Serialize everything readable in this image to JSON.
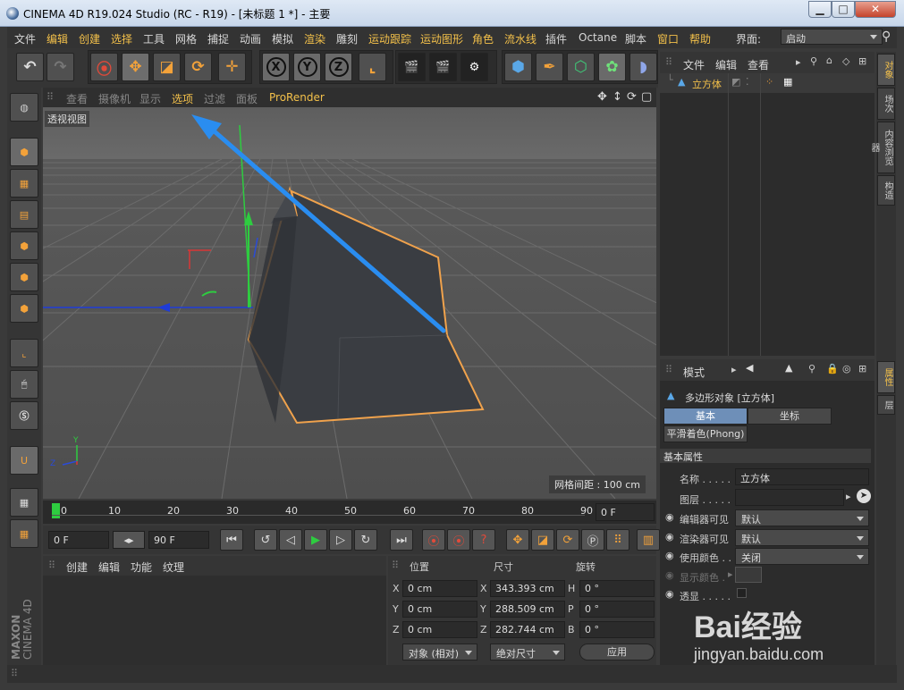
{
  "window": {
    "title": "CINEMA 4D R19.024 Studio (RC - R19) - [未标题 1 *] - 主要",
    "minimize": "▁",
    "maximize": "□",
    "close": "✕"
  },
  "menu": {
    "items": [
      "文件",
      "编辑",
      "创建",
      "选择",
      "工具",
      "网格",
      "捕捉",
      "动画",
      "模拟",
      "渲染",
      "雕刻",
      "运动跟踪",
      "运动图形",
      "角色",
      "流水线",
      "插件",
      "Octane",
      "脚本",
      "窗口",
      "帮助"
    ],
    "layout_label": "界面:",
    "layout_value": "启动"
  },
  "toolbar": {
    "axis_x": "X",
    "axis_y": "Y",
    "axis_z": "Z"
  },
  "viewport": {
    "menu": [
      "查看",
      "摄像机",
      "显示",
      "选项",
      "过滤",
      "面板"
    ],
    "active_menu": "选项",
    "prorender": "ProRender",
    "view_name": "透视视图",
    "grid_spacing": "网格间距 : 100 cm",
    "axis_y": "Y",
    "axis_z": "Z"
  },
  "timeline": {
    "ticks": [
      "0",
      "10",
      "20",
      "30",
      "40",
      "50",
      "60",
      "70",
      "80",
      "90"
    ],
    "current_frame": "0 F",
    "start_frame": "0 F",
    "end_frame": "90 F"
  },
  "materials": {
    "menu": [
      "创建",
      "编辑",
      "功能",
      "纹理"
    ]
  },
  "coords": {
    "headers": [
      "位置",
      "尺寸",
      "旋转"
    ],
    "rows": [
      {
        "axis": "X",
        "pos": "0 cm",
        "size_axis": "X",
        "size": "343.393 cm",
        "rot_axis": "H",
        "rot": "0 °"
      },
      {
        "axis": "Y",
        "pos": "0 cm",
        "size_axis": "Y",
        "size": "288.509 cm",
        "rot_axis": "P",
        "rot": "0 °"
      },
      {
        "axis": "Z",
        "pos": "0 cm",
        "size_axis": "Z",
        "size": "282.744 cm",
        "rot_axis": "B",
        "rot": "0 °"
      }
    ],
    "mode": "对象 (相对)",
    "size_mode": "绝对尺寸",
    "apply": "应用"
  },
  "objects": {
    "menu": [
      "文件",
      "编辑",
      "查看"
    ],
    "items": [
      {
        "name": "立方体"
      }
    ]
  },
  "attributes": {
    "menu": "模式",
    "object_title": "多边形对象 [立方体]",
    "tabs": [
      "基本",
      "坐标"
    ],
    "active_tab": "基本",
    "phong": "平滑着色(Phong)",
    "section": "基本属性",
    "fields": [
      {
        "label": "名称 . . . . .",
        "value": "立方体"
      },
      {
        "label": "图层 . . . . .",
        "value": ""
      },
      {
        "label": "编辑器可见",
        "value": "默认"
      },
      {
        "label": "渲染器可见",
        "value": "默认"
      },
      {
        "label": "使用颜色 . .",
        "value": "关闭"
      },
      {
        "label": "显示颜色 .",
        "value": ""
      },
      {
        "label": "透显 . . . . .",
        "value": ""
      }
    ]
  },
  "right_tabs": [
    "对象",
    "场次",
    "内容浏览器",
    "构造"
  ],
  "right_tabs2": [
    "属性",
    "层"
  ],
  "watermark": {
    "brand": "Bai经验",
    "url": "jingyan.baidu.com"
  },
  "maxon": {
    "line1": "MAXON",
    "line2": "CINEMA 4D"
  },
  "colors": {
    "accent": "#f3c04a",
    "edge_orange": "#f3a23a",
    "arrow_blue": "#2a8df0"
  }
}
